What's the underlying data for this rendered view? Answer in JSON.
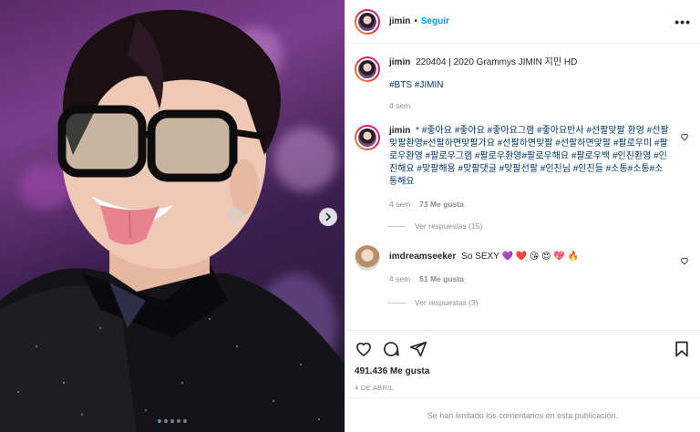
{
  "header": {
    "username": "jimin",
    "separator": "•",
    "follow_label": "Seguir",
    "more_label": "•••",
    "more_icon": "more-options-icon"
  },
  "caption": {
    "username": "jimin",
    "text": "220404 | 2020 Grammys JIMIN 지민 HD",
    "hashtags": "#BTS  #JIMIN",
    "time": "4 sem"
  },
  "comments": [
    {
      "username": "jimin",
      "text": "* #좋아요 #좋아요 #좋아요그램 #좋아요반사 #선팔맞팔 환영 #선팔맞팔환영#선팔하면맞팔가요 #선팔하면맞팔 #선팔하면맞팔 #팔로우미 #팔로우환영 #팔로우그램 #팔로우환영#팔로우해요 #팔로우백 #인친환영 #인친해요 #맞팔해용 #맞팔댓글 #맞팔선팔 #인친님 #인친들 #소통#소통#소통해요",
      "time": "4 sem",
      "likes": "73 Me gusta",
      "replies": "Ver respuestas (15)"
    },
    {
      "username": "imdreamseeker",
      "text": "So SEXY 💜 ❤️ 😘 😍 💖 🔥",
      "time": "4 sem",
      "likes": "51 Me gusta",
      "replies": "Ver respuestas (3)"
    }
  ],
  "actions": {
    "like_icon": "heart-icon",
    "comment_icon": "comment-icon",
    "share_icon": "share-icon",
    "save_icon": "bookmark-icon"
  },
  "stats": {
    "likes": "491.436 Me gusta",
    "date": "4 DE ABRIL"
  },
  "footer": {
    "limited_comments": "Se han limitado los comentarios en esta publicación."
  },
  "carousel": {
    "next_icon": "chevron-right-icon",
    "slides": 5,
    "active_index": 0
  },
  "colors": {
    "accent": "#0095f6",
    "hashtag": "#00376b",
    "muted": "#8e8e8e"
  }
}
